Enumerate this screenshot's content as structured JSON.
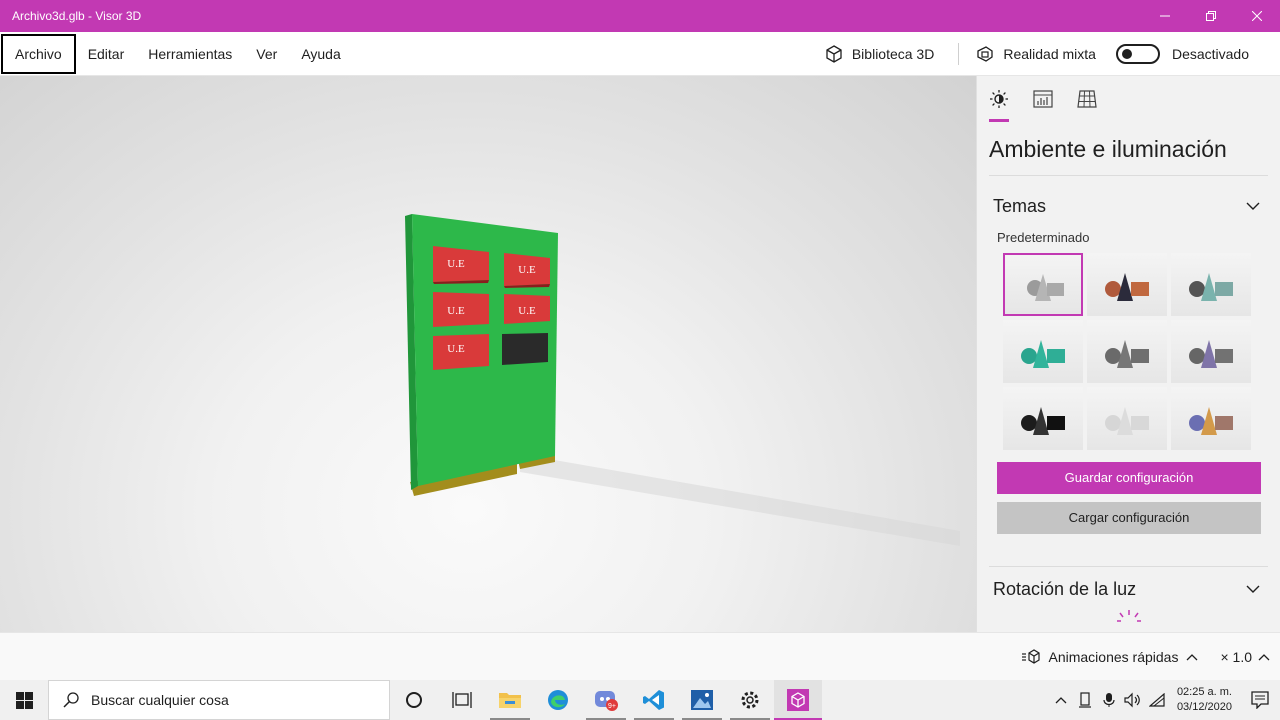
{
  "window": {
    "title": "Archivo3d.glb - Visor 3D",
    "accent_color": "#c239b3"
  },
  "menu": {
    "items": [
      "Archivo",
      "Editar",
      "Herramientas",
      "Ver",
      "Ayuda"
    ],
    "library_label": "Biblioteca 3D",
    "mixed_reality_label": "Realidad mixta",
    "mixed_reality_state": "Desactivado",
    "mixed_reality_on": false
  },
  "model": {
    "panel_labels": [
      "U.E",
      "U.E",
      "U.E",
      "U.E",
      "U.E"
    ],
    "board_color": "#2db84a",
    "label_color": "#d93a3a"
  },
  "panel": {
    "tabs": [
      "lighting-icon",
      "stats-icon",
      "grid-icon"
    ],
    "title": "Ambiente e iluminación",
    "themes_header": "Temas",
    "themes_sublabel": "Predeterminado",
    "save_button": "Guardar configuración",
    "load_button": "Cargar configuración",
    "light_rotation_header": "Rotación de la luz"
  },
  "status": {
    "animations_label": "Animaciones rápidas",
    "speed": "× 1.0"
  },
  "taskbar": {
    "search_placeholder": "Buscar cualquier cosa",
    "time": "02:25 a. m.",
    "date": "03/12/2020",
    "badge": "9+"
  }
}
